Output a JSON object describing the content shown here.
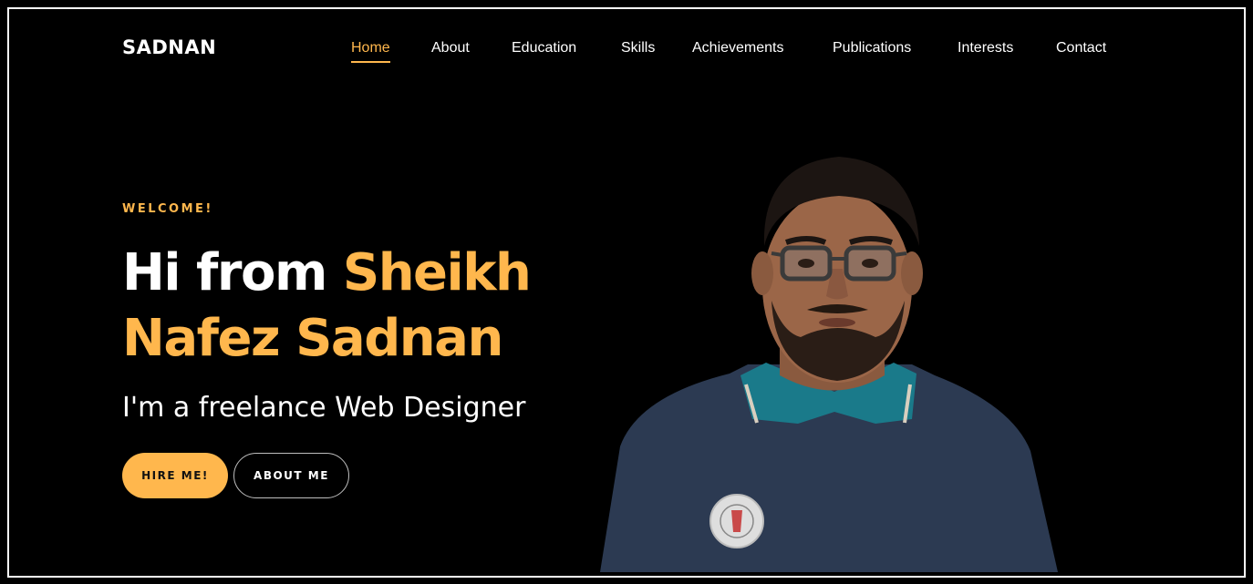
{
  "header": {
    "logo": "SADNAN",
    "nav": [
      {
        "label": "Home",
        "active": true
      },
      {
        "label": "About",
        "active": false
      },
      {
        "label": "Education",
        "active": false
      },
      {
        "label": "Skills",
        "active": false
      },
      {
        "label": "Achievements",
        "active": false
      },
      {
        "label": "Publications",
        "active": false
      },
      {
        "label": "Interests",
        "active": false
      },
      {
        "label": "Contact",
        "active": false
      }
    ]
  },
  "hero": {
    "welcome": "WELCOME!",
    "headline_white": "Hi from ",
    "headline_gold": "Sheikh Nafez Sadnan",
    "subtitle": "I'm a freelance Web Designer",
    "primary_button": "HIRE ME!",
    "secondary_button": "ABOUT ME",
    "portrait": "profile-photo"
  },
  "colors": {
    "background": "#000000",
    "accent": "#ffb74d",
    "text": "#ffffff",
    "shirt": "#2c3a52",
    "collar": "#1a7a8a"
  }
}
